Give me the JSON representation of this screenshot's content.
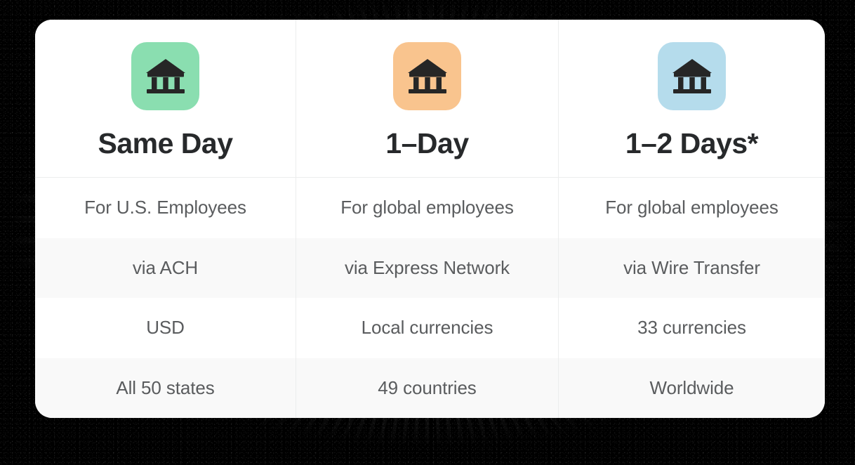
{
  "card": {
    "background_color": "#ffffff",
    "corner_radius": "24px"
  },
  "backdrop": {
    "color": "#000000",
    "texture": "grainy-noise"
  },
  "columns": [
    {
      "id": "same-day",
      "title": "Same Day",
      "icon": "bank-icon",
      "icon_tile_color": "#8ADEB0",
      "icon_glyph_color": "#262626",
      "cells": [
        "For U.S. Employees",
        "via ACH",
        "USD",
        "All 50 states"
      ]
    },
    {
      "id": "one-day",
      "title": "1–Day",
      "icon": "bank-icon",
      "icon_tile_color": "#F9C48E",
      "icon_glyph_color": "#262626",
      "cells": [
        "For global employees",
        "via Express Network",
        "Local currencies",
        "49 countries"
      ]
    },
    {
      "id": "one-to-two-days",
      "title": "1–2 Days*",
      "icon": "bank-icon",
      "icon_tile_color": "#B5DCEC",
      "icon_glyph_color": "#262626",
      "cells": [
        "For global employees",
        "via Wire Transfer",
        "33 currencies",
        "Worldwide"
      ]
    }
  ],
  "row_shading": [
    "white",
    "shaded",
    "white",
    "shaded"
  ],
  "styles": {
    "divider_color": "#eceded",
    "shaded_row_color": "#f9f9f9",
    "title_text_color": "#27292b",
    "body_text_color": "#5a5c5e"
  }
}
